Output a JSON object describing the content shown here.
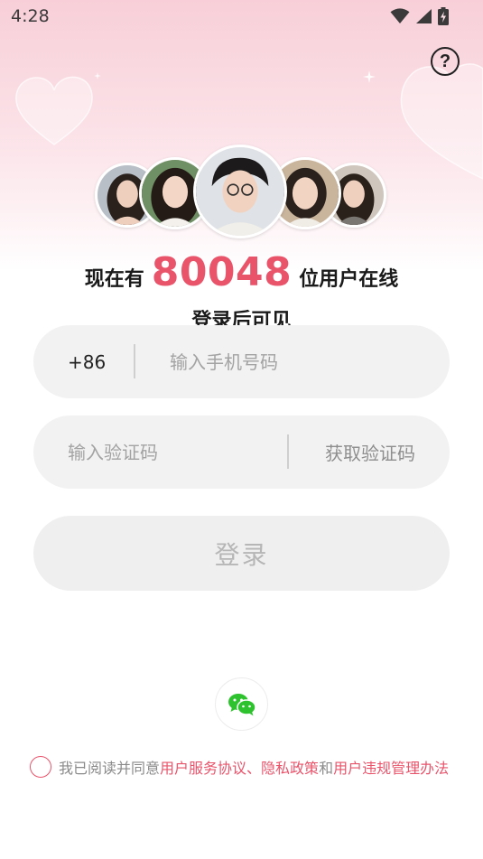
{
  "status_bar": {
    "time": "4:28",
    "icons": [
      "wifi-icon",
      "cellular-signal-icon",
      "battery-charging-icon"
    ]
  },
  "header": {
    "help_label": "?"
  },
  "online": {
    "prefix": "现在有",
    "count": "80048",
    "suffix": "位用户在线",
    "subtitle": "登录后可见"
  },
  "phone": {
    "country_code": "+86",
    "placeholder": "输入手机号码",
    "value": ""
  },
  "code": {
    "placeholder": "输入验证码",
    "value": "",
    "get_code_label": "获取验证码"
  },
  "login_button_label": "登录",
  "social_login": {
    "icon": "wechat-icon"
  },
  "agreement": {
    "checked": false,
    "prefix": "我已阅读并同意",
    "link_service": "用户服务协议",
    "sep1": "、",
    "link_privacy": "隐私政策",
    "sep2": "和",
    "link_violation": "用户违规管理办法"
  },
  "colors": {
    "accent": "#e9546b",
    "input_bg": "#f2f2f2",
    "wechat_green": "#2ec22e"
  }
}
